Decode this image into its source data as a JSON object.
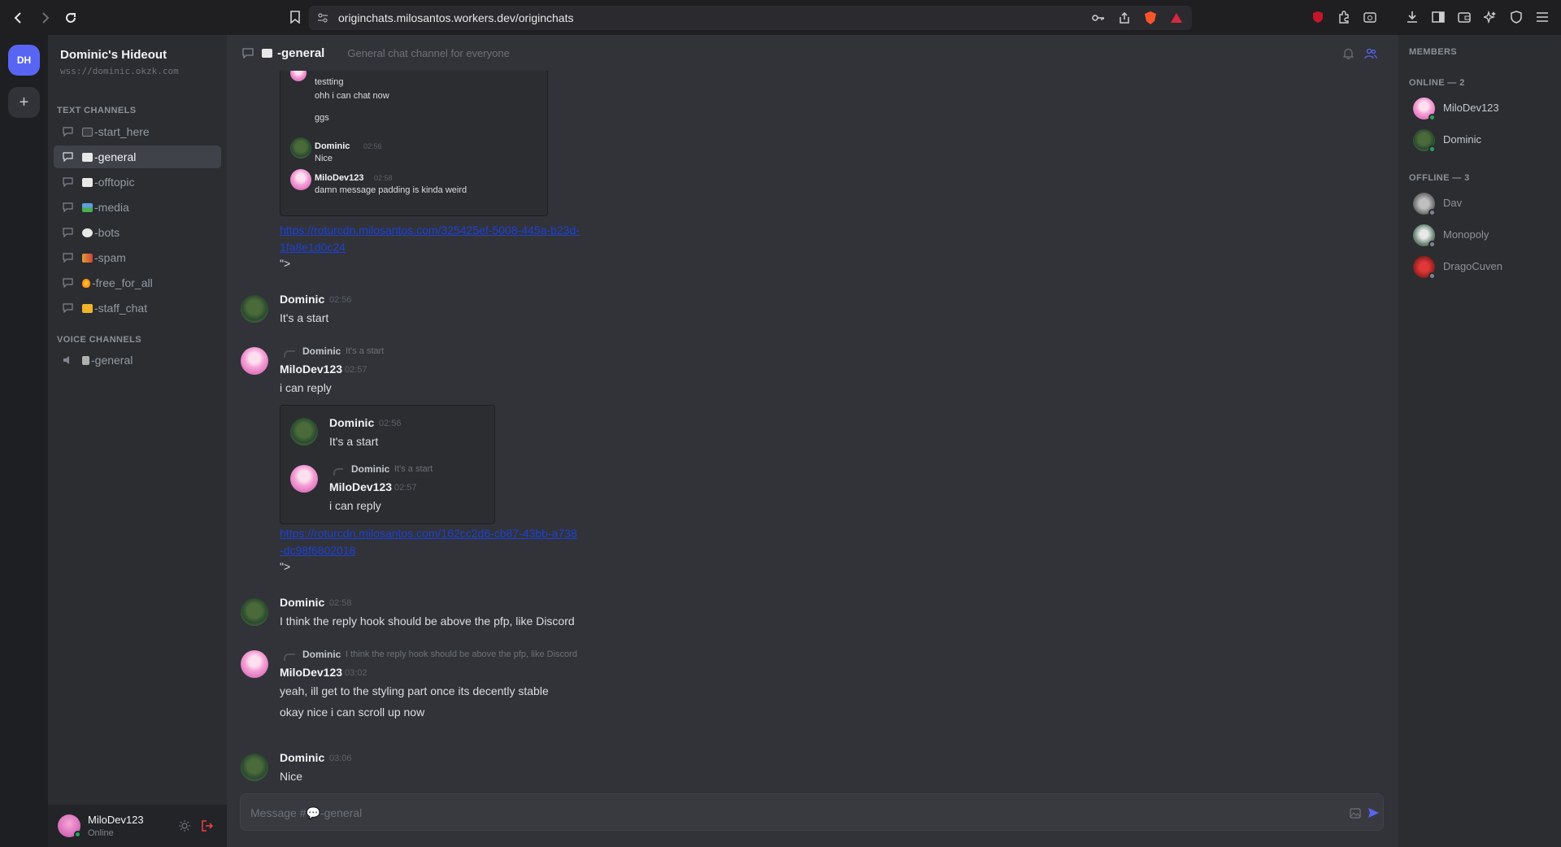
{
  "browser": {
    "url": "originchats.milosantos.workers.dev/originchats"
  },
  "server": {
    "initials": "DH",
    "name": "Dominic's Hideout",
    "address": "wss://dominic.okzk.com",
    "add_label": "+"
  },
  "sidebar": {
    "text_category": "TEXT CHANNELS",
    "voice_category": "VOICE CHANNELS",
    "channels": [
      {
        "label": "-start_here",
        "emoji": "📄"
      },
      {
        "label": "-general",
        "emoji": "💬"
      },
      {
        "label": "-offtopic",
        "emoji": "💬"
      },
      {
        "label": "-media",
        "emoji": "🖼"
      },
      {
        "label": "-bots",
        "emoji": "🛡"
      },
      {
        "label": "-spam",
        "emoji": "📢"
      },
      {
        "label": "-free_for_all",
        "emoji": "🔥"
      },
      {
        "label": "-staff_chat",
        "emoji": "👑"
      }
    ],
    "voice_channels": [
      {
        "label": "-general",
        "emoji": "🔈"
      }
    ]
  },
  "user_panel": {
    "name": "MiloDev123",
    "status": "Online"
  },
  "header": {
    "channel": "-general",
    "topic": "General chat channel for everyone"
  },
  "messages": {
    "embed1": {
      "line1": "testting",
      "line2": "ohh i can chat now",
      "line3": "ggs",
      "m1_user": "Dominic",
      "m1_time": "02:56",
      "m1_text": "Nice",
      "m2_user": "MiloDev123",
      "m2_time": "02:58",
      "m2_text": "damn message padding is kinda weird"
    },
    "link1": "https://roturcdn.milosantos.com/325425ef-5008-445a-b23d-1fa8e1d0c24",
    "quote_end": "\">",
    "m1": {
      "user": "Dominic",
      "time": "02:56",
      "text": "It's a start"
    },
    "m2": {
      "reply_user": "Dominic",
      "reply_text": "It's a start",
      "user": "MiloDev123",
      "time": "02:57",
      "text": "i can reply",
      "embed": {
        "a_user": "Dominic",
        "a_time": "02:56",
        "a_text": "It's a start",
        "b_reply_user": "Dominic",
        "b_reply_text": "It's a start",
        "b_user": "MiloDev123",
        "b_time": "02:57",
        "b_text": "i can reply"
      },
      "link": "https://roturcdn.milosantos.com/162cc2d6-cb87-43bb-a738-dc98f6802018"
    },
    "m3": {
      "user": "Dominic",
      "time": "02:58",
      "text": "I think the reply hook should be above the pfp, like Discord"
    },
    "m4": {
      "reply_user": "Dominic",
      "reply_text": "I think the reply hook should be above the pfp, like Discord",
      "user": "MiloDev123",
      "time": "03:02",
      "text1": "yeah, ill get to the styling part once its decently stable",
      "text2": "okay nice i can scroll up now"
    },
    "m5": {
      "user": "Dominic",
      "time": "03:06",
      "text": "Nice"
    }
  },
  "composer": {
    "placeholder": "Message #💬-general"
  },
  "members": {
    "title": "MEMBERS",
    "online_header": "ONLINE — 2",
    "offline_header": "OFFLINE — 3",
    "online": [
      {
        "name": "MiloDev123"
      },
      {
        "name": "Dominic"
      }
    ],
    "offline": [
      {
        "name": "Dav"
      },
      {
        "name": "Monopoly"
      },
      {
        "name": "DragoCuven"
      }
    ]
  },
  "colors": {
    "accent": "#5865f2",
    "online": "#23a55a",
    "offline": "#80848e",
    "link": "#1e40d6",
    "logout": "#f23f43"
  }
}
